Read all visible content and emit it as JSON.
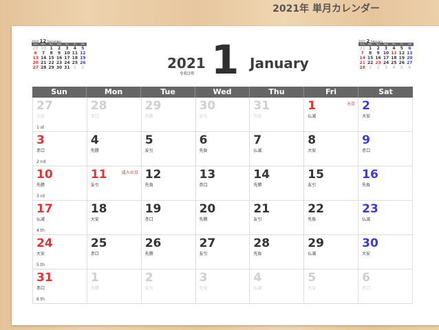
{
  "banner": "2021年 単月カレンダー",
  "header": {
    "year": "2021",
    "era": "令和3年",
    "month_number": "1",
    "month_name": "January"
  },
  "mini_prev": {
    "year": "2020",
    "month_number": "12",
    "month_name": "December",
    "weekdays": [
      "Sun",
      "Mon",
      "Tue",
      "Wed",
      "Thu",
      "Fri",
      "Sat"
    ],
    "days": [
      {
        "d": "29",
        "c": "gray"
      },
      {
        "d": "30",
        "c": "gray"
      },
      {
        "d": "1",
        "c": ""
      },
      {
        "d": "2",
        "c": ""
      },
      {
        "d": "3",
        "c": ""
      },
      {
        "d": "4",
        "c": ""
      },
      {
        "d": "5",
        "c": "blue"
      },
      {
        "d": "6",
        "c": "red"
      },
      {
        "d": "7",
        "c": ""
      },
      {
        "d": "8",
        "c": ""
      },
      {
        "d": "9",
        "c": ""
      },
      {
        "d": "10",
        "c": ""
      },
      {
        "d": "11",
        "c": ""
      },
      {
        "d": "12",
        "c": "blue"
      },
      {
        "d": "13",
        "c": "red"
      },
      {
        "d": "14",
        "c": ""
      },
      {
        "d": "15",
        "c": ""
      },
      {
        "d": "16",
        "c": ""
      },
      {
        "d": "17",
        "c": ""
      },
      {
        "d": "18",
        "c": ""
      },
      {
        "d": "19",
        "c": "blue"
      },
      {
        "d": "20",
        "c": "red"
      },
      {
        "d": "21",
        "c": ""
      },
      {
        "d": "22",
        "c": ""
      },
      {
        "d": "23",
        "c": ""
      },
      {
        "d": "24",
        "c": ""
      },
      {
        "d": "25",
        "c": ""
      },
      {
        "d": "26",
        "c": "blue"
      },
      {
        "d": "27",
        "c": "red"
      },
      {
        "d": "28",
        "c": ""
      },
      {
        "d": "29",
        "c": ""
      },
      {
        "d": "30",
        "c": ""
      },
      {
        "d": "31",
        "c": ""
      },
      {
        "d": "1",
        "c": "gray"
      },
      {
        "d": "2",
        "c": "gray"
      }
    ]
  },
  "mini_next": {
    "year": "2021",
    "month_number": "2",
    "month_name": "February",
    "weekdays": [
      "Sun",
      "Mon",
      "Tue",
      "Wed",
      "Thu",
      "Fri",
      "Sat"
    ],
    "days": [
      {
        "d": "31",
        "c": "gray"
      },
      {
        "d": "1",
        "c": ""
      },
      {
        "d": "2",
        "c": ""
      },
      {
        "d": "3",
        "c": ""
      },
      {
        "d": "4",
        "c": ""
      },
      {
        "d": "5",
        "c": ""
      },
      {
        "d": "6",
        "c": "blue"
      },
      {
        "d": "7",
        "c": "red"
      },
      {
        "d": "8",
        "c": ""
      },
      {
        "d": "9",
        "c": ""
      },
      {
        "d": "10",
        "c": ""
      },
      {
        "d": "11",
        "c": "red"
      },
      {
        "d": "12",
        "c": ""
      },
      {
        "d": "13",
        "c": "blue"
      },
      {
        "d": "14",
        "c": "red"
      },
      {
        "d": "15",
        "c": ""
      },
      {
        "d": "16",
        "c": ""
      },
      {
        "d": "17",
        "c": ""
      },
      {
        "d": "18",
        "c": ""
      },
      {
        "d": "19",
        "c": ""
      },
      {
        "d": "20",
        "c": "blue"
      },
      {
        "d": "21",
        "c": "red"
      },
      {
        "d": "22",
        "c": ""
      },
      {
        "d": "23",
        "c": "red"
      },
      {
        "d": "24",
        "c": ""
      },
      {
        "d": "25",
        "c": ""
      },
      {
        "d": "26",
        "c": ""
      },
      {
        "d": "27",
        "c": "blue"
      },
      {
        "d": "28",
        "c": "red"
      },
      {
        "d": "1",
        "c": "gray"
      },
      {
        "d": "2",
        "c": "gray"
      },
      {
        "d": "3",
        "c": "gray"
      },
      {
        "d": "4",
        "c": "gray"
      },
      {
        "d": "5",
        "c": "gray"
      },
      {
        "d": "6",
        "c": "gray"
      }
    ]
  },
  "weekdays": [
    "Sun",
    "Mon",
    "Tue",
    "Wed",
    "Thu",
    "Fri",
    "Sat"
  ],
  "days": [
    {
      "n": "27",
      "r": "大安",
      "cls": "out"
    },
    {
      "n": "28",
      "r": "赤口",
      "cls": "out"
    },
    {
      "n": "29",
      "r": "先勝",
      "cls": "out"
    },
    {
      "n": "30",
      "r": "友引",
      "cls": "out"
    },
    {
      "n": "31",
      "r": "先負",
      "cls": "out"
    },
    {
      "n": "1",
      "r": "仏滅",
      "cls": "red",
      "h": "元日"
    },
    {
      "n": "2",
      "r": "大安",
      "cls": "blue"
    },
    {
      "n": "3",
      "r": "赤口",
      "cls": "red"
    },
    {
      "n": "4",
      "r": "先勝",
      "cls": ""
    },
    {
      "n": "5",
      "r": "友引",
      "cls": ""
    },
    {
      "n": "6",
      "r": "先負",
      "cls": ""
    },
    {
      "n": "7",
      "r": "仏滅",
      "cls": ""
    },
    {
      "n": "8",
      "r": "大安",
      "cls": ""
    },
    {
      "n": "9",
      "r": "赤口",
      "cls": "blue"
    },
    {
      "n": "10",
      "r": "先勝",
      "cls": "red"
    },
    {
      "n": "11",
      "r": "友引",
      "cls": "red",
      "h": "成人の日"
    },
    {
      "n": "12",
      "r": "先負",
      "cls": ""
    },
    {
      "n": "13",
      "r": "赤口",
      "cls": ""
    },
    {
      "n": "14",
      "r": "先勝",
      "cls": ""
    },
    {
      "n": "15",
      "r": "友引",
      "cls": ""
    },
    {
      "n": "16",
      "r": "先負",
      "cls": "blue"
    },
    {
      "n": "17",
      "r": "仏滅",
      "cls": "red"
    },
    {
      "n": "18",
      "r": "大安",
      "cls": ""
    },
    {
      "n": "19",
      "r": "赤口",
      "cls": ""
    },
    {
      "n": "20",
      "r": "先勝",
      "cls": ""
    },
    {
      "n": "21",
      "r": "友引",
      "cls": ""
    },
    {
      "n": "22",
      "r": "先負",
      "cls": ""
    },
    {
      "n": "23",
      "r": "仏滅",
      "cls": "blue"
    },
    {
      "n": "24",
      "r": "大安",
      "cls": "red"
    },
    {
      "n": "25",
      "r": "赤口",
      "cls": ""
    },
    {
      "n": "26",
      "r": "先勝",
      "cls": ""
    },
    {
      "n": "27",
      "r": "友引",
      "cls": ""
    },
    {
      "n": "28",
      "r": "先負",
      "cls": ""
    },
    {
      "n": "29",
      "r": "仏滅",
      "cls": ""
    },
    {
      "n": "30",
      "r": "大安",
      "cls": "blue"
    },
    {
      "n": "31",
      "r": "赤口",
      "cls": "red"
    },
    {
      "n": "1",
      "r": "先勝",
      "cls": "out"
    },
    {
      "n": "2",
      "r": "友引",
      "cls": "out"
    },
    {
      "n": "3",
      "r": "先負",
      "cls": "out"
    },
    {
      "n": "4",
      "r": "仏滅",
      "cls": "out"
    },
    {
      "n": "5",
      "r": "大安",
      "cls": "out"
    },
    {
      "n": "6",
      "r": "赤口",
      "cls": "out"
    }
  ],
  "week_labels": [
    "1 st",
    "2 nd",
    "3 rd",
    "4 th",
    "5 th",
    "6 th"
  ],
  "colors": {
    "sunday": "#e23434",
    "saturday": "#3a3ad6",
    "header_bg": "#666666",
    "faded": "#cfcfcf"
  }
}
